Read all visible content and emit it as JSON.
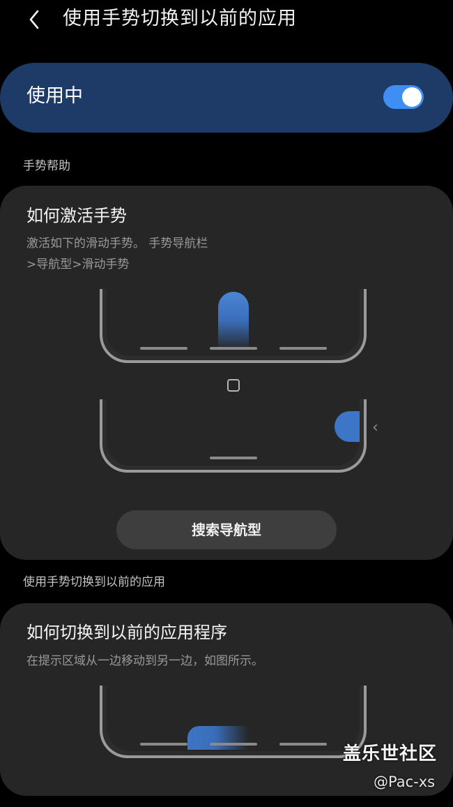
{
  "header": {
    "title": "使用手势切换到以前的应用",
    "back_icon": "back-arrow-icon"
  },
  "master_switch": {
    "label": "使用中",
    "state": "on",
    "accent": "#3e8ef3",
    "background": "#1d3b66"
  },
  "sections": {
    "gesture_help": "手势帮助",
    "switch_app": "使用手势切换到以前的应用"
  },
  "card_activate": {
    "title": "如何激活手势",
    "description": "激活如下的滑动手势。 手势导航栏>导航型>滑动手势",
    "button_label": "搜索导航型",
    "icons": [
      "home-icon",
      "chevron-left-icon"
    ]
  },
  "card_switch": {
    "title": "如何切换到以前的应用程序",
    "description": "在提示区域从一边移动到另一边，如图所示。"
  },
  "watermark": {
    "brand": "盖乐世社区",
    "user": "@Pac-xs"
  }
}
